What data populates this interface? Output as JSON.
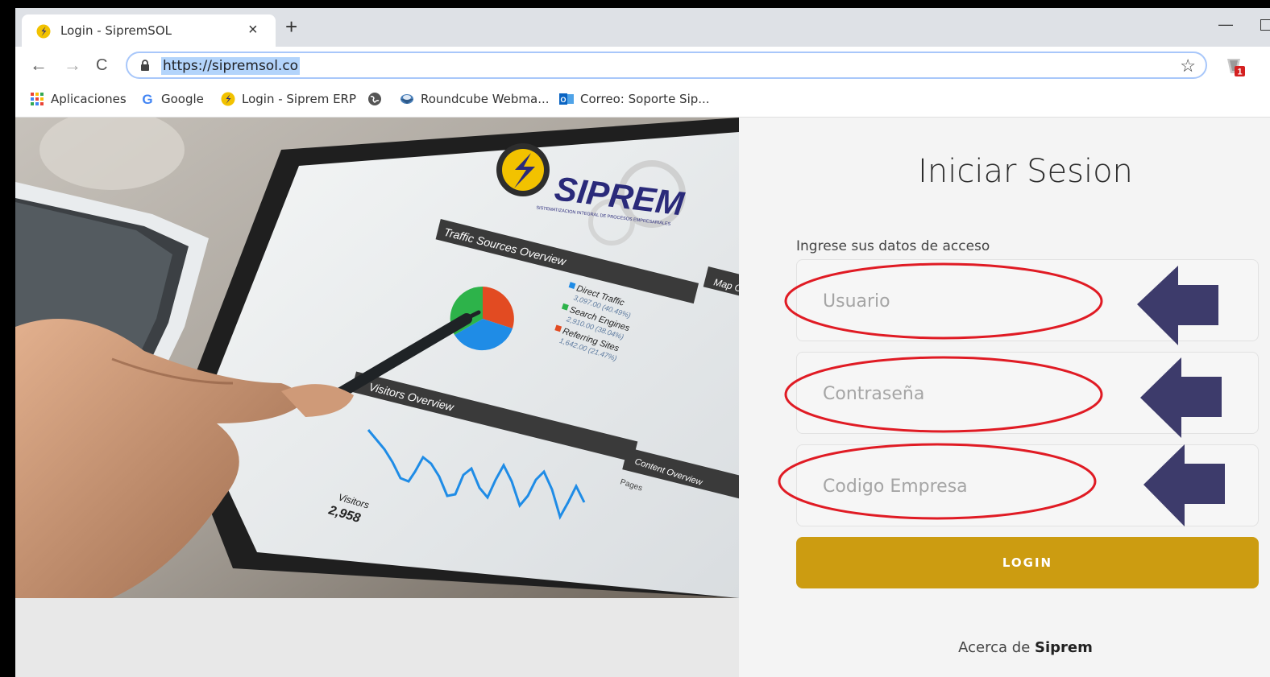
{
  "browser": {
    "tab": {
      "title": "Login - SipremSOL",
      "close": "×"
    },
    "new_tab": "+",
    "window_min": "—",
    "nav": {
      "back": "←",
      "forward": "→",
      "reload": "C"
    },
    "url": "https://sipremsol.co",
    "star": "☆",
    "extension_badge": "1",
    "bookmarks": [
      {
        "label": "Aplicaciones",
        "icon": "apps-grid-icon"
      },
      {
        "label": "Google",
        "icon": "google-icon"
      },
      {
        "label": "Login - Siprem ERP",
        "icon": "siprem-icon"
      },
      {
        "label": "",
        "icon": "globe-icon"
      },
      {
        "label": "Roundcube Webma...",
        "icon": "roundcube-icon"
      },
      {
        "label": "Correo: Soporte Sip...",
        "icon": "outlook-icon"
      }
    ]
  },
  "hero": {
    "brand": "SIPREM",
    "brand_tagline": "SISTEMATIZACION INTEGRAL DE PROCESOS EMPRESARIALES",
    "panel1_title": "Traffic Sources Overview",
    "legend": [
      {
        "label": "Direct Traffic",
        "value": "3,097.00 (40.49%)"
      },
      {
        "label": "Search Engines",
        "value": "2,910.00 (38.04%)"
      },
      {
        "label": "Referring Sites",
        "value": "1,642.00 (21.47%)"
      }
    ],
    "panel2_title": "Visitors Overview",
    "visitors_label": "Visitors",
    "visitors_value": "2,958",
    "map_label": "Map O",
    "content_label": "Content Overview",
    "pages_label": "Pages"
  },
  "login": {
    "title": "Iniciar Sesion",
    "subtitle": "Ingrese sus datos de acceso",
    "fields": [
      {
        "placeholder": "Usuario"
      },
      {
        "placeholder": "Contraseña"
      },
      {
        "placeholder": "Codigo Empresa"
      }
    ],
    "button": "LOGIN",
    "about_prefix": "Acerca de",
    "about_brand": "Siprem"
  },
  "colors": {
    "annotation_ellipse": "#e01b24",
    "annotation_arrow": "#3d3b6b",
    "button": "#cc9c11",
    "pie": [
      "#1f8ce6",
      "#2db34a",
      "#e24b22"
    ]
  }
}
